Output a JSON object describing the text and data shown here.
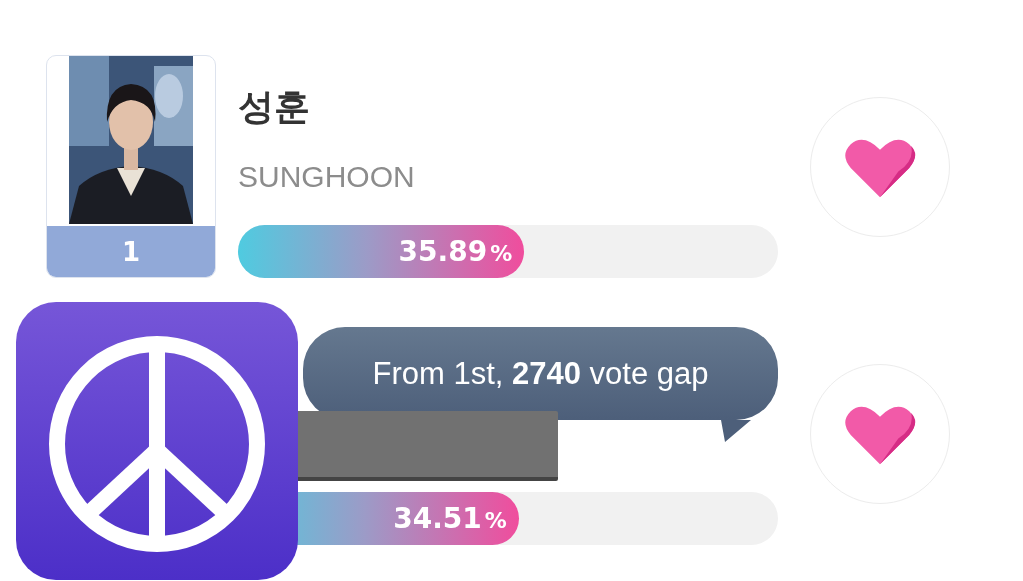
{
  "candidates": [
    {
      "rank": "1",
      "name": "성훈",
      "name_latin": "SUNGHOON",
      "percent": "35.89",
      "unit": "%",
      "level": 0.53
    },
    {
      "percent": "34.51",
      "unit": "%",
      "level": 0.52
    }
  ],
  "tooltip": {
    "text": "From 1st, **2740** vote gap"
  }
}
